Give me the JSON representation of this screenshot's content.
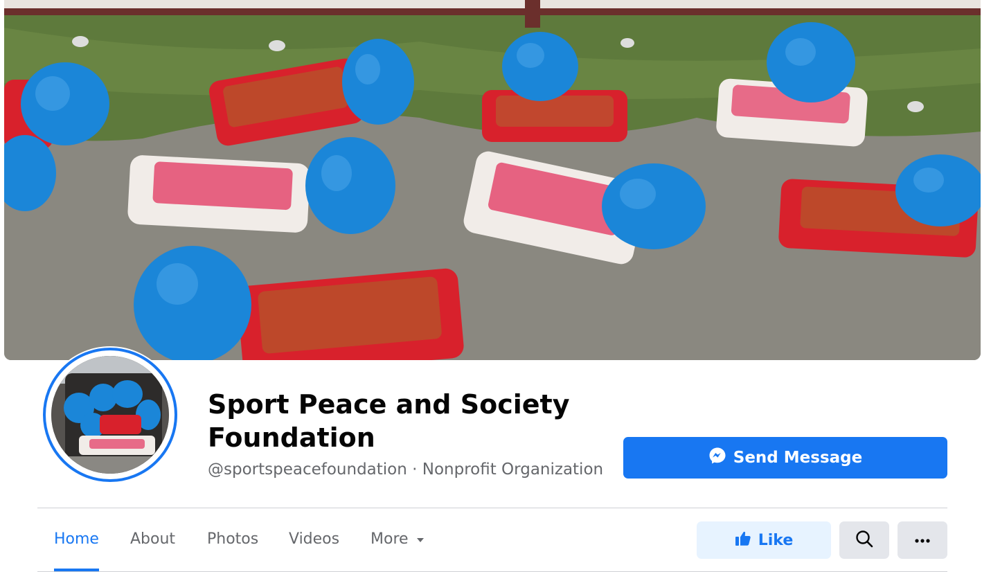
{
  "page": {
    "title": "Sport Peace and Society Foundation",
    "handle": "@sportspeacefoundation",
    "separator": " · ",
    "category": "Nonprofit Organization"
  },
  "actions": {
    "send_message_label": "Send Message",
    "like_label": "Like"
  },
  "tabs": [
    {
      "label": "Home",
      "active": true
    },
    {
      "label": "About"
    },
    {
      "label": "Photos"
    },
    {
      "label": "Videos"
    },
    {
      "label": "More"
    }
  ],
  "icons": {
    "send_message": "messenger-icon",
    "like": "thumbs-up-icon",
    "search": "search-icon",
    "more_options": "ellipsis-icon",
    "more_tab": "caret-down-icon"
  },
  "colors": {
    "accent": "#1877f2",
    "like_bg": "#e7f3ff",
    "secondary_bg": "#e4e6eb",
    "muted_text": "#65676b"
  }
}
